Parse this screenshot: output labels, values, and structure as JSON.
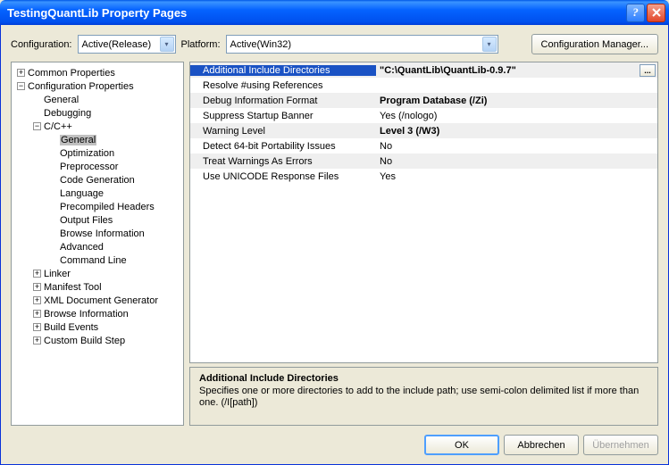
{
  "titlebar": {
    "title": "TestingQuantLib Property Pages"
  },
  "config": {
    "configurationLabel": "Configuration:",
    "configurationValue": "Active(Release)",
    "platformLabel": "Platform:",
    "platformValue": "Active(Win32)",
    "managerButton": "Configuration Manager..."
  },
  "tree": {
    "commonProps": "Common Properties",
    "configProps": "Configuration Properties",
    "general": "General",
    "debugging": "Debugging",
    "cpp": "C/C++",
    "cppGeneral": "General",
    "optimization": "Optimization",
    "preprocessor": "Preprocessor",
    "codeGen": "Code Generation",
    "language": "Language",
    "precompiled": "Precompiled Headers",
    "outputFiles": "Output Files",
    "browseInfo": "Browse Information",
    "advanced": "Advanced",
    "cmdLine": "Command Line",
    "linker": "Linker",
    "manifest": "Manifest Tool",
    "xmlDoc": "XML Document Generator",
    "browseInfo2": "Browse Information",
    "buildEvents": "Build Events",
    "customBuild": "Custom Build Step"
  },
  "props": {
    "r0": {
      "label": "Additional Include Directories",
      "value": "\"C:\\QuantLib\\QuantLib-0.9.7\""
    },
    "r1": {
      "label": "Resolve #using References",
      "value": ""
    },
    "r2": {
      "label": "Debug Information Format",
      "value": "Program Database (/Zi)"
    },
    "r3": {
      "label": "Suppress Startup Banner",
      "value": "Yes (/nologo)"
    },
    "r4": {
      "label": "Warning Level",
      "value": "Level 3 (/W3)"
    },
    "r5": {
      "label": "Detect 64-bit Portability Issues",
      "value": "No"
    },
    "r6": {
      "label": "Treat Warnings As Errors",
      "value": "No"
    },
    "r7": {
      "label": "Use UNICODE Response Files",
      "value": "Yes"
    }
  },
  "desc": {
    "title": "Additional Include Directories",
    "text": "Specifies one or more directories to add to the include path; use semi-colon delimited list if more than one.     (/I[path])"
  },
  "buttons": {
    "ok": "OK",
    "cancel": "Abbrechen",
    "apply": "Übernehmen"
  },
  "browseBtn": "..."
}
